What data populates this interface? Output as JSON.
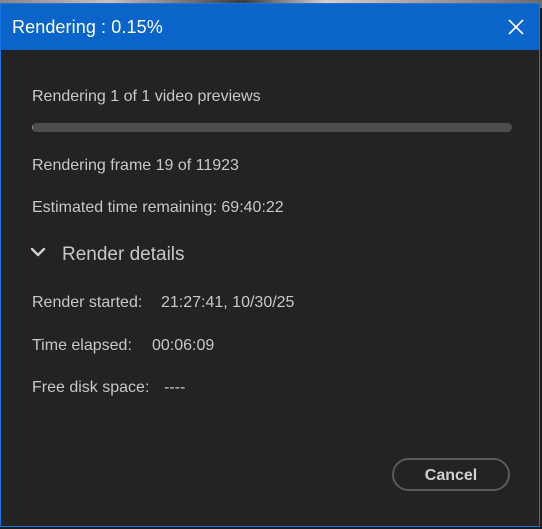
{
  "dialog": {
    "title": "Rendering : 0.15%",
    "close_icon": "close-icon"
  },
  "progress": {
    "summary": "Rendering 1 of 1 video previews",
    "fraction": 0.0015,
    "frame_text": "Rendering frame 19 of 11923",
    "time_remaining_text": "Estimated time remaining: 69:40:22"
  },
  "details": {
    "toggle_label": "Render details",
    "toggle_icon": "chevron-down-icon",
    "render_started_label": "Render started:",
    "render_started_value": "21:27:41, 10/30/25",
    "time_elapsed_label": "Time elapsed:",
    "time_elapsed_value": "00:06:09",
    "free_disk_label": "Free disk space:",
    "free_disk_value": "----"
  },
  "actions": {
    "cancel_label": "Cancel"
  },
  "colors": {
    "titlebar": "#0a64c9",
    "background": "#232323",
    "text": "#c8c8c8",
    "progress_track": "#4d4d4d"
  }
}
